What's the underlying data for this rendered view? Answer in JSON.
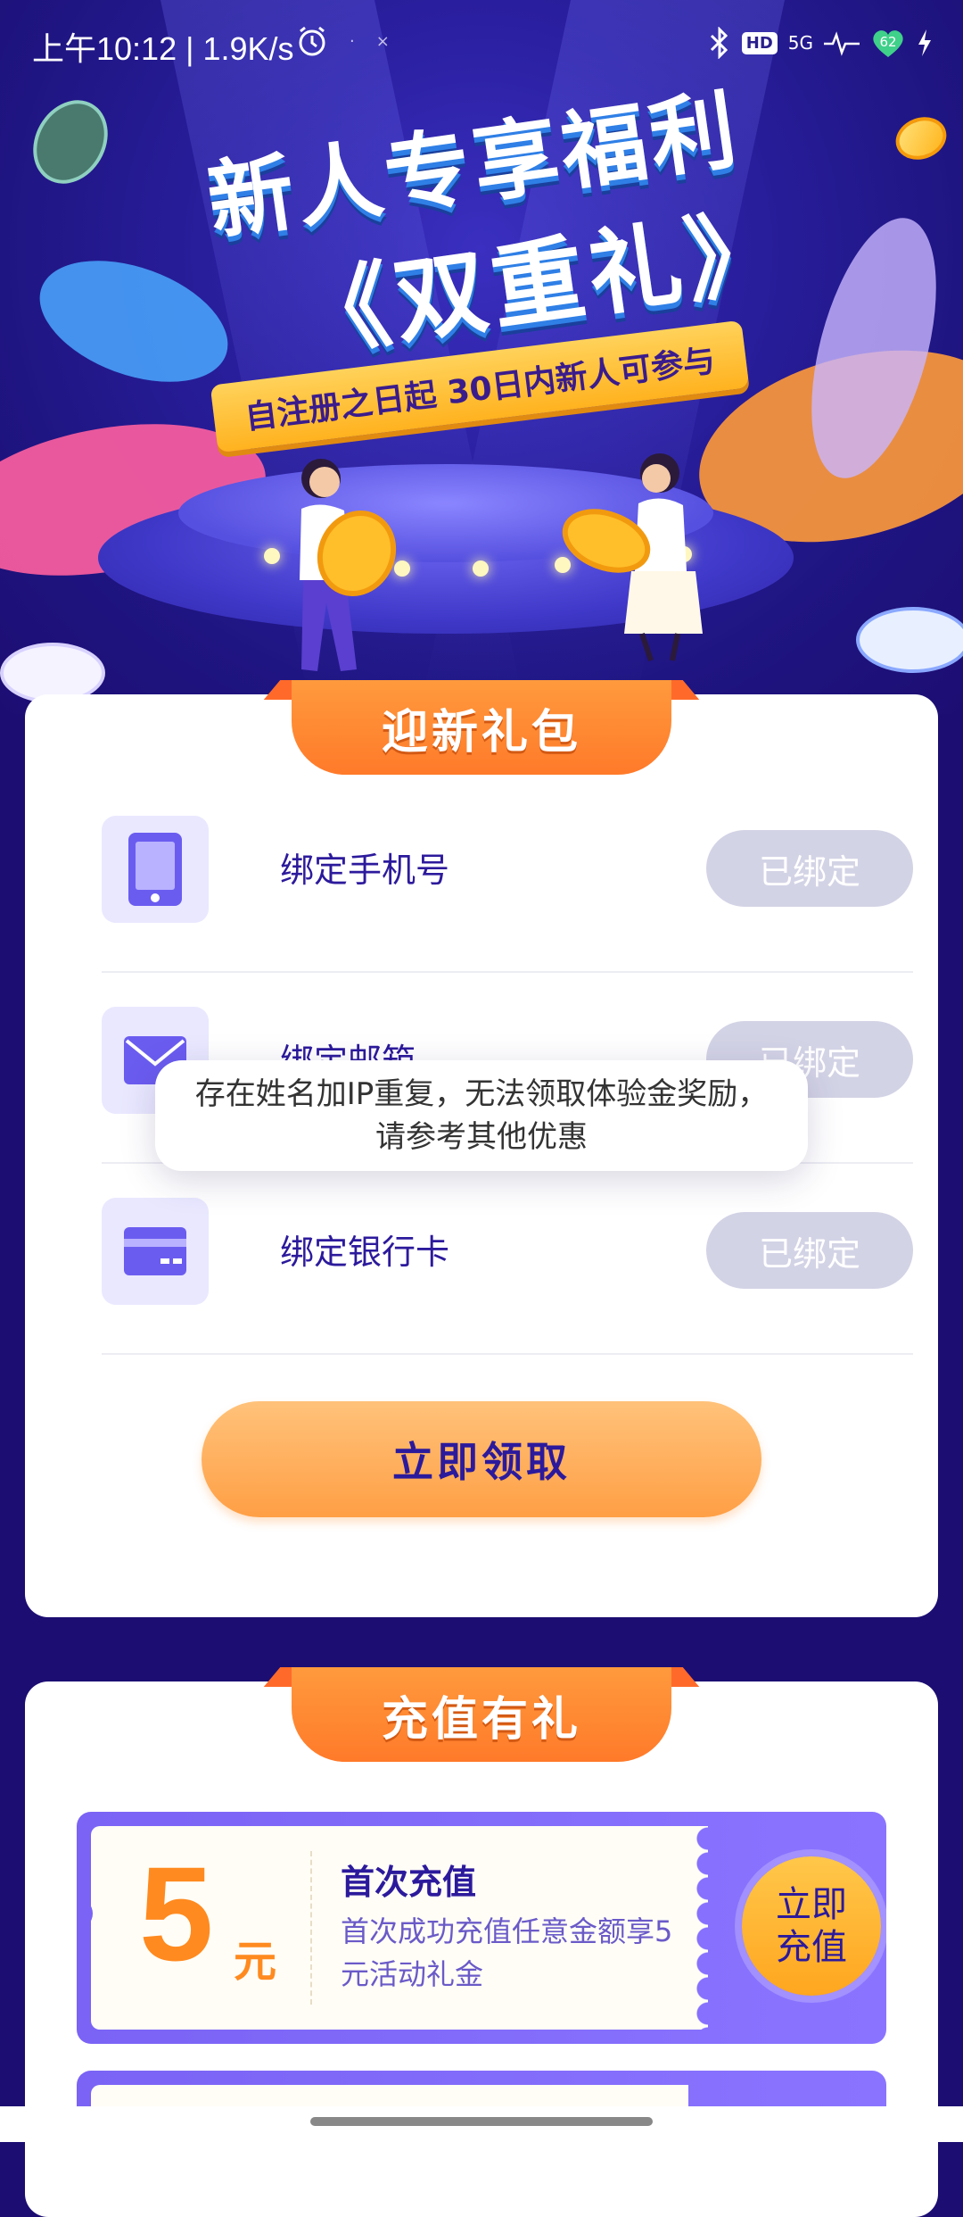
{
  "status_bar": {
    "time": "上午10:12 | 1.9K/s",
    "network_label": "5G",
    "battery_level": "62"
  },
  "banner": {
    "title_line1": "新人专享福利",
    "title_line2": "《双重礼》",
    "ribbon_text": "自注册之日起 30日内新人可参与"
  },
  "welcome_pack": {
    "header": "迎新礼包",
    "items": [
      {
        "label": "绑定手机号",
        "status": "已绑定",
        "icon": "phone-icon"
      },
      {
        "label": "绑定邮箱",
        "status": "已绑定",
        "icon": "mail-icon"
      },
      {
        "label": "绑定银行卡",
        "status": "已绑定",
        "icon": "card-icon"
      }
    ],
    "claim_label": "立即领取"
  },
  "toast": {
    "message": "存在姓名加IP重复，无法领取体验金奖励，请参考其他优惠"
  },
  "recharge": {
    "header": "充值有礼",
    "coupons": [
      {
        "amount": "5",
        "unit": "元",
        "title": "首次充值",
        "desc": "首次成功充值任意金额享5元活动礼金",
        "button": "立即充值"
      }
    ]
  },
  "colors": {
    "page_bg": "#1c0d72",
    "accent_orange": "#ff8a1f",
    "text_purple": "#2c1a9c",
    "coupon_purple": "#7a63f5"
  }
}
